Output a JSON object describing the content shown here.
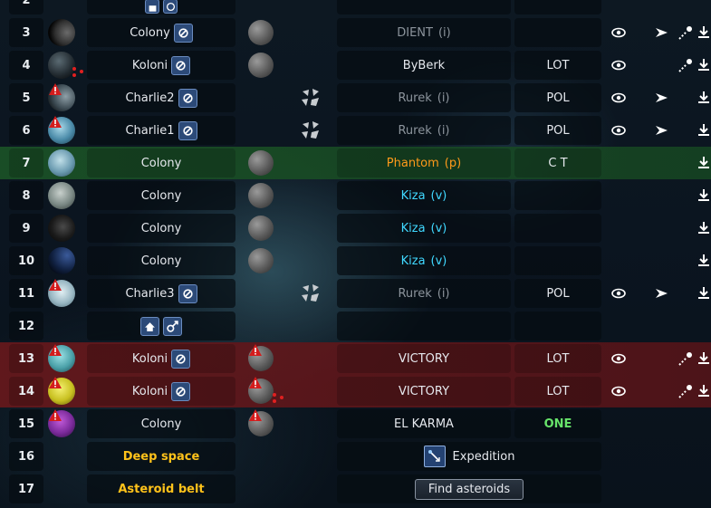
{
  "rows": [
    {
      "pos": "2"
    },
    {
      "pos": "3",
      "name": "Colony",
      "player": "DIENT",
      "status": "(i)",
      "alliance": ""
    },
    {
      "pos": "4",
      "name": "Koloni",
      "player": "ByBerk",
      "status": "",
      "alliance": "LOT"
    },
    {
      "pos": "5",
      "name": "Charlie2",
      "player": "Rurek",
      "status": "(i)",
      "alliance": "POL"
    },
    {
      "pos": "6",
      "name": "Charlie1",
      "player": "Rurek",
      "status": "(i)",
      "alliance": "POL"
    },
    {
      "pos": "7",
      "name": "Colony",
      "player": "Phantom",
      "status": "(p)",
      "alliance": "C T"
    },
    {
      "pos": "8",
      "name": "Colony",
      "player": "Kiza",
      "status": "(v)",
      "alliance": ""
    },
    {
      "pos": "9",
      "name": "Colony",
      "player": "Kiza",
      "status": "(v)",
      "alliance": ""
    },
    {
      "pos": "10",
      "name": "Colony",
      "player": "Kiza",
      "status": "(v)",
      "alliance": ""
    },
    {
      "pos": "11",
      "name": "Charlie3",
      "player": "Rurek",
      "status": "(i)",
      "alliance": "POL"
    },
    {
      "pos": "12"
    },
    {
      "pos": "13",
      "name": "Koloni",
      "player": "VICTORY",
      "status": "",
      "alliance": "LOT"
    },
    {
      "pos": "14",
      "name": "Koloni",
      "player": "VICTORY",
      "status": "",
      "alliance": "LOT"
    },
    {
      "pos": "15",
      "name": "Colony",
      "player": "EL KARMA",
      "status": "",
      "alliance": "ONE"
    },
    {
      "pos": "16",
      "name": "Deep space",
      "action": "Expedition"
    },
    {
      "pos": "17",
      "name": "Asteroid belt",
      "action": "Find asteroids"
    }
  ],
  "icons": {
    "spy": "eye-icon",
    "message": "send-message-icon",
    "missile": "missile-icon",
    "download": "download-icon",
    "colonize": "colonize-icon",
    "recycle": "recycle-icon",
    "debris": "debris-field-icon",
    "warning": "warning-icon",
    "moon": "moon-icon"
  },
  "colors": {
    "inactive": "#8c949c",
    "vacation": "#40d8ff",
    "protected": "#ff9a1a",
    "ally": "#67e36a",
    "special": "#ffc21a",
    "own_row": "#1a5026",
    "enemy_row": "#64181c"
  }
}
